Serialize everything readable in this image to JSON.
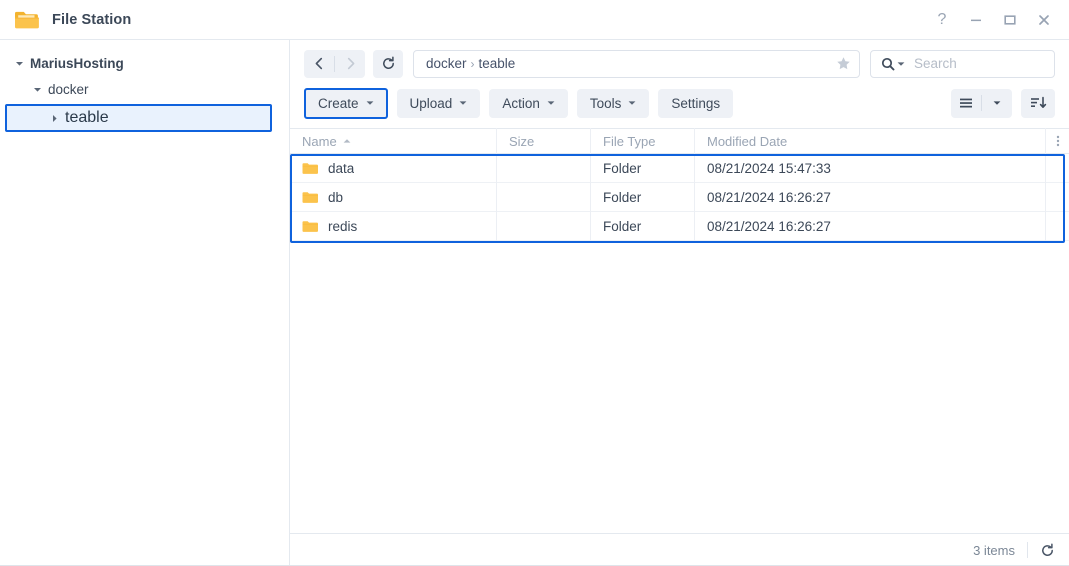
{
  "window": {
    "title": "File Station",
    "icon": "folder-open-icon",
    "controls": {
      "help": "?",
      "minimize": "minimize-icon",
      "maximize": "maximize-icon",
      "close": "close-icon"
    }
  },
  "sidebar": {
    "items": [
      {
        "label": "MariusHosting",
        "level": 0,
        "expander": "caret-down",
        "selected": false
      },
      {
        "label": "docker",
        "level": 1,
        "expander": "caret-down",
        "selected": false
      },
      {
        "label": "teable",
        "level": 2,
        "expander": "caret-right",
        "selected": true
      }
    ]
  },
  "nav": {
    "back": "back-arrow-icon",
    "forward": "forward-arrow-icon",
    "refresh": "refresh-icon",
    "breadcrumb": [
      "docker",
      "teable"
    ],
    "breadcrumb_separator": "›",
    "favorite": "star-icon"
  },
  "search": {
    "icon": "search-icon",
    "caret": "caret-down",
    "placeholder": "Search",
    "value": ""
  },
  "toolbar": {
    "buttons": [
      {
        "label": "Create",
        "dropdown": true,
        "highlighted": true
      },
      {
        "label": "Upload",
        "dropdown": true,
        "highlighted": false
      },
      {
        "label": "Action",
        "dropdown": true,
        "highlighted": false
      },
      {
        "label": "Tools",
        "dropdown": true,
        "highlighted": false
      },
      {
        "label": "Settings",
        "dropdown": false,
        "highlighted": false
      }
    ],
    "view_button": "list-view-icon",
    "view_caret": "caret-down",
    "sort_button": "sort-descending-icon"
  },
  "filelist": {
    "columns": [
      "Name",
      "Size",
      "File Type",
      "Modified Date"
    ],
    "sort_column": "Name",
    "sort_direction": "ascending",
    "kebab": "more-options-icon",
    "rows": [
      {
        "name": "data",
        "size": "",
        "type": "Folder",
        "modified": "08/21/2024 15:47:33"
      },
      {
        "name": "db",
        "size": "",
        "type": "Folder",
        "modified": "08/21/2024 16:26:27"
      },
      {
        "name": "redis",
        "size": "",
        "type": "Folder",
        "modified": "08/21/2024 16:26:27"
      }
    ]
  },
  "status": {
    "count": "3 items",
    "refresh": "refresh-icon"
  },
  "colors": {
    "highlight": "#0f62dd",
    "selection_fill": "#e9f2fd",
    "folder": "#fbc34c",
    "toolbar_button": "#eef1f6"
  }
}
